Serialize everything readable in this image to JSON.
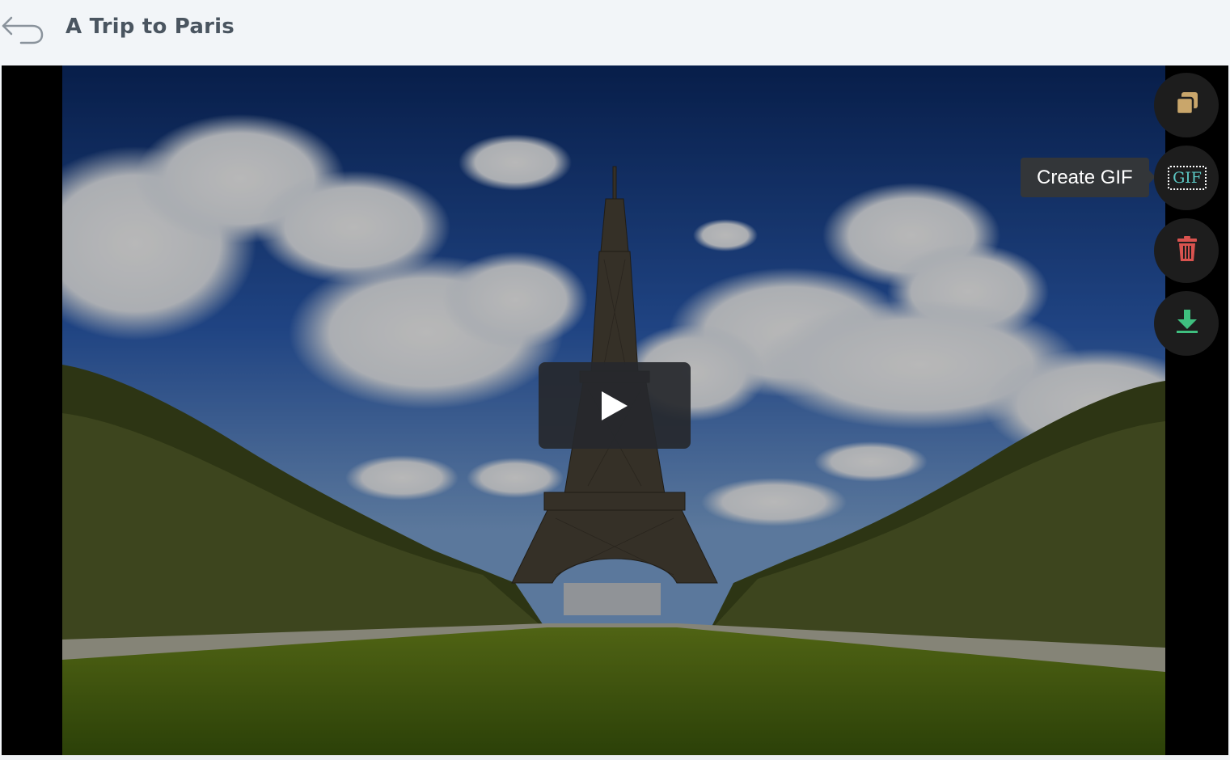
{
  "header": {
    "back_icon": "back-arrow-icon",
    "title": "A Trip to Paris"
  },
  "player": {
    "scene": "Eiffel Tower photo",
    "play_icon": "play-icon"
  },
  "actions": [
    {
      "id": "duplicate",
      "icon": "duplicate-icon",
      "color": "#c9a66b"
    },
    {
      "id": "create-gif",
      "icon": "gif-icon",
      "label": "GIF",
      "tooltip": "Create GIF",
      "color": "#5bc8c4"
    },
    {
      "id": "delete",
      "icon": "trash-icon",
      "color": "#d9534f"
    },
    {
      "id": "download",
      "icon": "download-icon",
      "color": "#3fbf7f"
    }
  ],
  "tooltip": {
    "text": "Create GIF"
  }
}
